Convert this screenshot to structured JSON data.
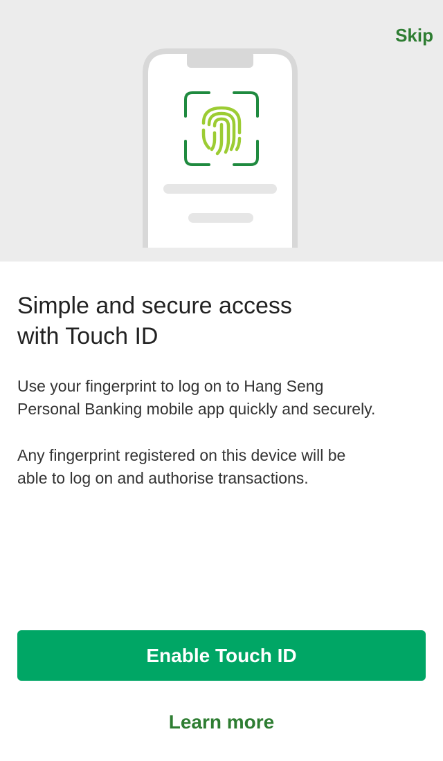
{
  "header": {
    "skip_label": "Skip"
  },
  "illustration": {
    "icon": "fingerprint-icon",
    "frame_color": "#1f8a3f",
    "fingerprint_color": "#9ccc33",
    "phone_outline_color": "#d8d8d8"
  },
  "content": {
    "title": "Simple and secure access\nwith Touch ID",
    "paragraph_1": "Use your fingerprint to log on to Hang Seng\nPersonal Banking mobile app quickly and securely.",
    "paragraph_2": "Any fingerprint registered on this device will be\nable to log on and authorise transactions."
  },
  "actions": {
    "primary_label": "Enable Touch ID",
    "secondary_label": "Learn more"
  },
  "colors": {
    "accent_green": "#00a665",
    "link_green": "#2e7d32",
    "hero_background": "#ececec"
  }
}
